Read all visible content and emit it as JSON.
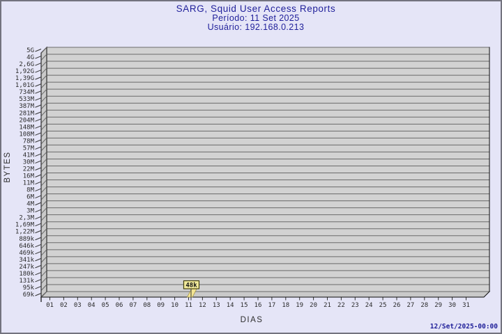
{
  "page": {
    "background_color": "#e5e5f7",
    "border_color": "#73737e"
  },
  "header": {
    "title": "SARG, Squid User Access Reports",
    "subtitle_period": "Período: 11 Set 2025",
    "subtitle_user": "Usuário: 192.168.0.213",
    "title_color": "#1f1f9a"
  },
  "footer": {
    "timestamp": "12/Set/2025-00:00",
    "timestamp_color": "#20209a"
  },
  "chart_data": {
    "type": "bar",
    "title": "SARG, Squid User Access Reports",
    "subtitle1": "Período: 11 Set 2025",
    "subtitle2": "Usuário: 192.168.0.213",
    "xlabel": "DIAS",
    "ylabel": "BYTES",
    "x_tick_labels": [
      "01",
      "02",
      "03",
      "04",
      "05",
      "06",
      "07",
      "08",
      "09",
      "10",
      "11",
      "12",
      "13",
      "14",
      "15",
      "16",
      "17",
      "18",
      "19",
      "20",
      "21",
      "22",
      "23",
      "24",
      "25",
      "26",
      "27",
      "28",
      "29",
      "30",
      "31"
    ],
    "y_tick_labels": [
      "5G",
      "4G",
      "2,6G",
      "1,92G",
      "1,39G",
      "1,01G",
      "734M",
      "533M",
      "387M",
      "281M",
      "204M",
      "148M",
      "108M",
      "78M",
      "57M",
      "41M",
      "30M",
      "22M",
      "16M",
      "11M",
      "8M",
      "6M",
      "4M",
      "3M",
      "2,3M",
      "1,69M",
      "1,22M",
      "889k",
      "646k",
      "469k",
      "341k",
      "247k",
      "180k",
      "131k",
      "95k",
      "69k"
    ],
    "values": [
      0,
      0,
      0,
      0,
      0,
      0,
      0,
      0,
      0,
      0,
      48000,
      0,
      0,
      0,
      0,
      0,
      0,
      0,
      0,
      0,
      0,
      0,
      0,
      0,
      0,
      0,
      0,
      0,
      0,
      0,
      0
    ],
    "annotations": [
      {
        "day": "11",
        "label": "48k"
      }
    ],
    "legend": null,
    "grid": true,
    "style_3d": true,
    "colors": {
      "plot_background": "#d2d2d2",
      "wall": "#c9c9c9",
      "grid_line": "#6a6a6a",
      "frame": "#0a0a0a",
      "bar": "#f3e493",
      "bar_edge": "#9f9148",
      "callout_fill": "#f2ea9c",
      "callout_border": "#44400a"
    }
  }
}
